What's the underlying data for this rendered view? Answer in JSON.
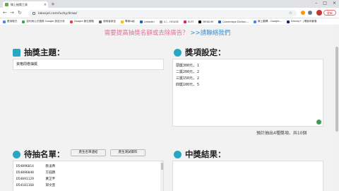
{
  "browser": {
    "tab_title": "線上抽獎工具",
    "url": "lakosjel.com/lucky/draw/",
    "update_label": "更新"
  },
  "bookmarks": [
    {
      "label": "應用程式",
      "color": "#4285f4"
    },
    {
      "label": "如何用公式換算 Google 設定分析",
      "color": "#34a853"
    },
    {
      "label": "Google 數位經驗",
      "color": "#ea4335"
    },
    {
      "label": "使用者設定",
      "color": "#5f6368"
    },
    {
      "label": "專案&組",
      "color": "#fbbc05"
    },
    {
      "label": "LinkedIn",
      "color": "#0a66c2"
    },
    {
      "label": "C:\\ - HOUSE",
      "color": "#9e9e9e"
    },
    {
      "label": "EUTI",
      "color": "#e91e63"
    },
    {
      "label": "MEDIUM",
      "color": "#000000"
    },
    {
      "label": "Cambridge Diction...",
      "color": "#1565c0"
    },
    {
      "label": "線上翻譯 - Google...",
      "color": "#4285f4"
    },
    {
      "label": "Disney+ | 電影和影集",
      "color": "#1a237e"
    }
  ],
  "banner": {
    "text": "需要提高抽獎名額或去除廣告？",
    "link": ">>請聯絡我們"
  },
  "topic": {
    "title": "抽獎主題：",
    "value": "資格問卷抽獎"
  },
  "prizes": {
    "title": "獎項設定：",
    "lines": [
      "頭獎300元, 1",
      "二獎200元, 2",
      "三獎150元, 2",
      "四獎100元, 5"
    ],
    "summary": "預計抽出4種獎項、共10個"
  },
  "candidates": {
    "title": "待抽名單：",
    "btn_generate": "產生名單連結",
    "btn_test": "產生測試資料",
    "rows": [
      "D54096014      歐凌菁",
      "D54096048      方鈺霖",
      "D54091129      黃芷芊",
      "D54101168      邱文芸"
    ]
  },
  "results": {
    "title": "中獎結果："
  },
  "colors": {
    "accent_teal": "#2aa7c0",
    "accent_green": "#3c9a54",
    "banner_pink": "#e0739a",
    "banner_link": "#3d8fd1"
  }
}
